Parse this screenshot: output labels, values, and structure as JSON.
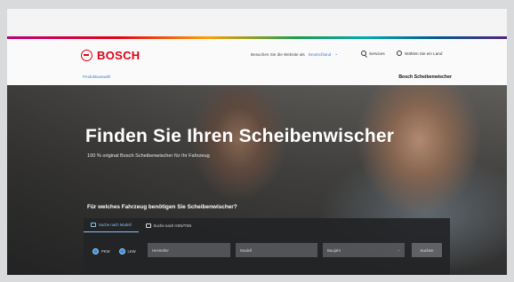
{
  "brand": {
    "name": "BOSCH",
    "color": "#e20015",
    "accent": "#3b7fd1"
  },
  "header": {
    "visit_prompt": "Besuchen Sie die Website als",
    "country": "Deutschland",
    "search_label": "Services",
    "region_label": "Wählen Sie ein Land",
    "breadcrumb": "Produktauswahl",
    "page_name": "Bosch Scheibenwischer"
  },
  "hero": {
    "headline": "Finden Sie Ihren Scheibenwischer",
    "subline": "100 % original Bosch Scheibenwischer für Ihr Fahrzeug"
  },
  "search": {
    "question": "Für welches Fahrzeug benötigen Sie Scheibenwischer?",
    "tabs": [
      {
        "label": "Suche nach Modell",
        "icon": "car-icon"
      },
      {
        "label": "Suche nach HSN/TSN",
        "icon": "document-icon"
      }
    ],
    "radios": [
      {
        "label": "PKW",
        "selected": true
      },
      {
        "label": "LKW",
        "selected": false
      }
    ],
    "fields": [
      {
        "placeholder": "Hersteller"
      },
      {
        "placeholder": "Modell"
      },
      {
        "placeholder": "Baujahr"
      }
    ],
    "submit_label": "Suchen"
  }
}
